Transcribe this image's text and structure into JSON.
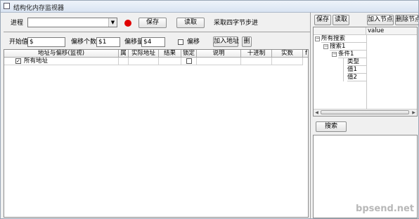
{
  "window": {
    "title": "结构化内存监视器"
  },
  "toolbar": {
    "process_label": "进程",
    "process_value": "",
    "save_label": "保存",
    "read_label": "读取",
    "step_label": "采取四字节步进"
  },
  "params": {
    "start_label": "开始值",
    "start_value": "$",
    "count_label": "偏移个数",
    "count_value": "$1",
    "offset_label": "偏移量",
    "offset_value": "$4",
    "offset_chk_label": "偏移",
    "add_addr_label": "加入地址",
    "delete_label": "删"
  },
  "table": {
    "columns": [
      "地址与偏移(监视)",
      "属",
      "实际地址",
      "结果",
      "锁定",
      "说明",
      "十进制",
      "实数",
      "f"
    ],
    "rows": [
      {
        "checked": true,
        "label": "所有地址"
      }
    ]
  },
  "right": {
    "save_label": "保存",
    "read_label": "读取",
    "add_node_label": "加入节点",
    "del_node_label": "删除节点",
    "value_header": "value",
    "tree": [
      "所有搜索",
      "搜索1",
      "条件1",
      "类型",
      "值1",
      "值2"
    ],
    "search_label": "搜索"
  },
  "watermark": "bpsend.net",
  "colors": {
    "record": "#e00000",
    "title_bg": "#dbe6f4"
  }
}
